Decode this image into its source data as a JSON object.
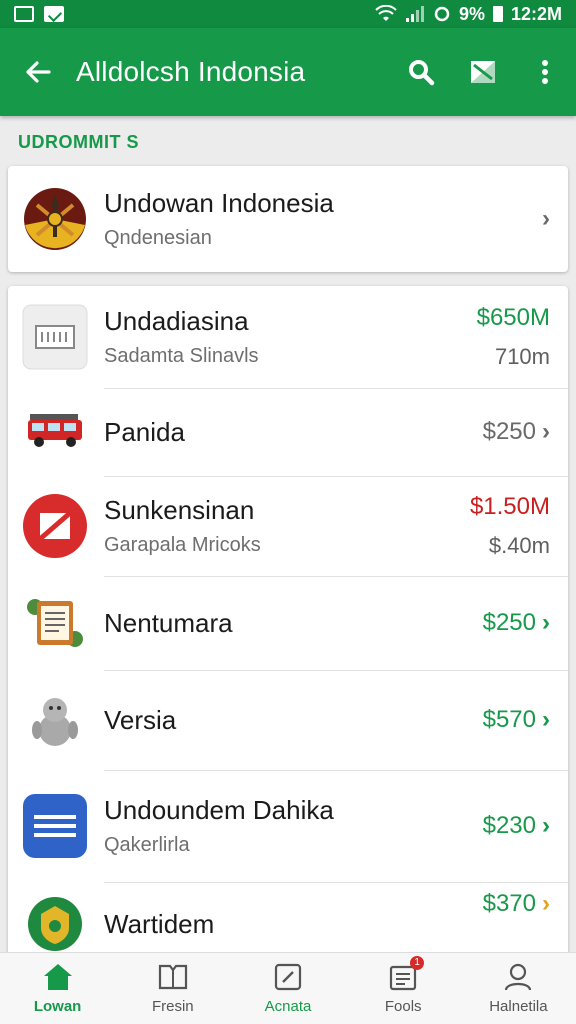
{
  "status_bar": {
    "battery": "9%",
    "time": "12:2M"
  },
  "app_bar": {
    "title": "Alldolcsh Indonsia"
  },
  "section": {
    "label": "UDROMMIT S"
  },
  "top_card": {
    "name": "Undowan Indonesia",
    "subtitle": "Qndenesian"
  },
  "items": [
    {
      "name": "Undadiasina",
      "subtitle": "Sadamta Slinavls",
      "amount": "$650M",
      "amount_color": "#17994a",
      "secondary": "710m"
    },
    {
      "name": "Panida",
      "subtitle": "",
      "amount": "$250",
      "amount_color": "#6a6a6a",
      "secondary": ""
    },
    {
      "name": "Sunkensinan",
      "subtitle": "Garapala Mricoks",
      "amount": "$1.50M",
      "amount_color": "#c8201f",
      "secondary": "$.40m"
    },
    {
      "name": "Nentumara",
      "subtitle": "",
      "amount": "$250",
      "amount_color": "#17994a",
      "secondary": ""
    },
    {
      "name": "Versia",
      "subtitle": "",
      "amount": "$570",
      "amount_color": "#17994a",
      "secondary": ""
    },
    {
      "name": "Undoundem Dahika",
      "subtitle": "Qakerlirla",
      "amount": "$230",
      "amount_color": "#17994a",
      "secondary": ""
    },
    {
      "name": "Wartidem",
      "subtitle": "",
      "amount": "$370",
      "amount_color": "#17994a",
      "secondary": ""
    }
  ],
  "bottom_nav": [
    {
      "label": "Lowan",
      "icon": "home-icon"
    },
    {
      "label": "Fresin",
      "icon": "book-icon"
    },
    {
      "label": "Acnata",
      "icon": "edit-icon"
    },
    {
      "label": "Fools",
      "icon": "inbox-icon",
      "badge": "1"
    },
    {
      "label": "Halnetila",
      "icon": "person-icon"
    }
  ],
  "colors": {
    "primary": "#17994a",
    "status_bar": "#0f8a3f",
    "negative": "#c8201f"
  }
}
